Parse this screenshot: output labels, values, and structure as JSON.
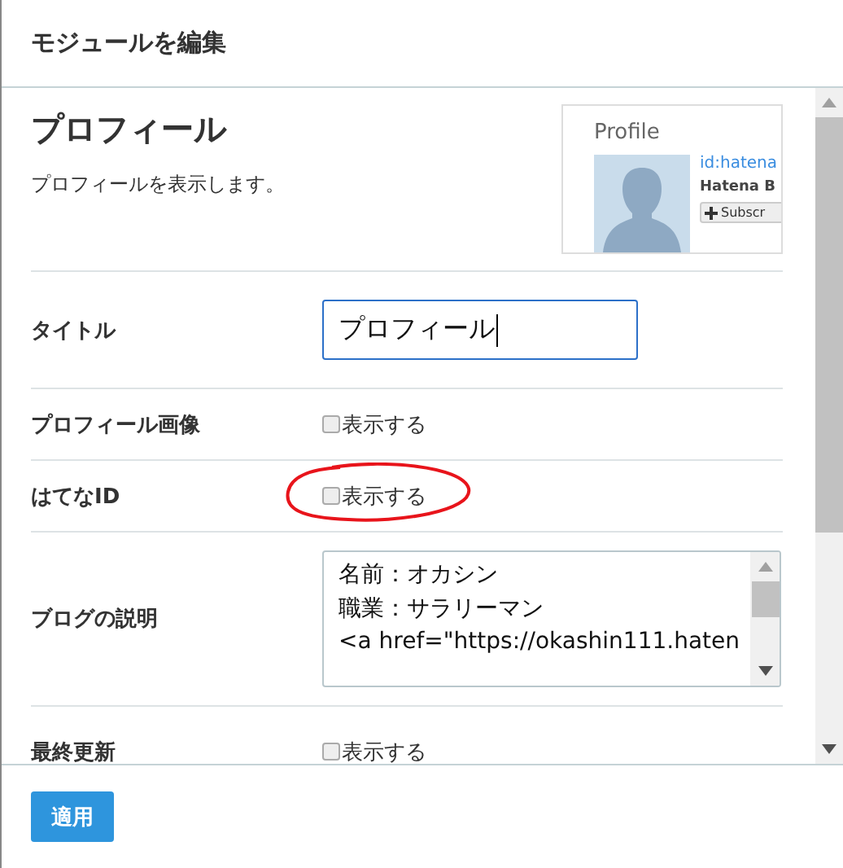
{
  "dialog": {
    "title": "モジュールを編集"
  },
  "module": {
    "name": "プロフィール",
    "description": "プロフィールを表示します。",
    "preview": {
      "heading": "Profile",
      "user_id": "id:hatena",
      "user_name": "Hatena B",
      "subscribe_button": "Subscr"
    }
  },
  "fields": [
    {
      "kind": "text",
      "label": "タイトル",
      "value": "プロフィール",
      "focused": true
    },
    {
      "kind": "checkbox",
      "label": "プロフィール画像",
      "option": "表示する",
      "checked": false,
      "circled": false
    },
    {
      "kind": "checkbox",
      "label": "はてなID",
      "option": "表示する",
      "checked": false,
      "circled": true
    },
    {
      "kind": "textarea",
      "label": "ブログの説明",
      "lines": [
        "名前：オカシン",
        "職業：サラリーマン",
        "<a href=\"https://okashin111.haten"
      ]
    },
    {
      "kind": "checkbox",
      "label": "最終更新",
      "option": "表示する",
      "checked": false,
      "circled": false
    }
  ],
  "buttons": [
    {
      "label": "適用"
    }
  ]
}
